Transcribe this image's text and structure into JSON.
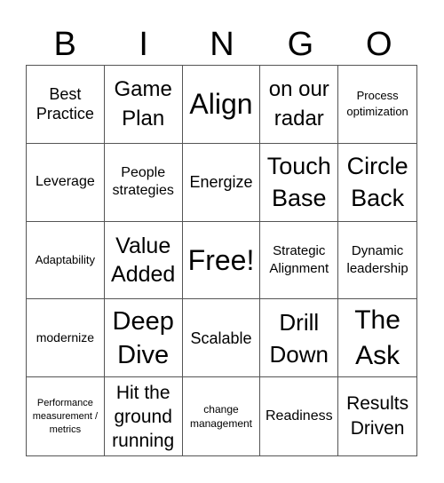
{
  "header": {
    "letters": [
      "B",
      "I",
      "N",
      "G",
      "O"
    ]
  },
  "cells": [
    [
      "Best Practice",
      "Game Plan",
      "Align",
      "on our radar",
      "Process optimization"
    ],
    [
      "Leverage",
      "People strategies",
      "Energize",
      "Touch Base",
      "Circle Back"
    ],
    [
      "Adaptability",
      "Value Added",
      "Free!",
      "Strategic Alignment",
      "Dynamic leadership"
    ],
    [
      "modernize",
      "Deep Dive",
      "Scalable",
      "Drill Down",
      "The Ask"
    ],
    [
      "Performance measurement / metrics",
      "Hit the ground running",
      "change management",
      "Readiness",
      "Results Driven"
    ]
  ]
}
